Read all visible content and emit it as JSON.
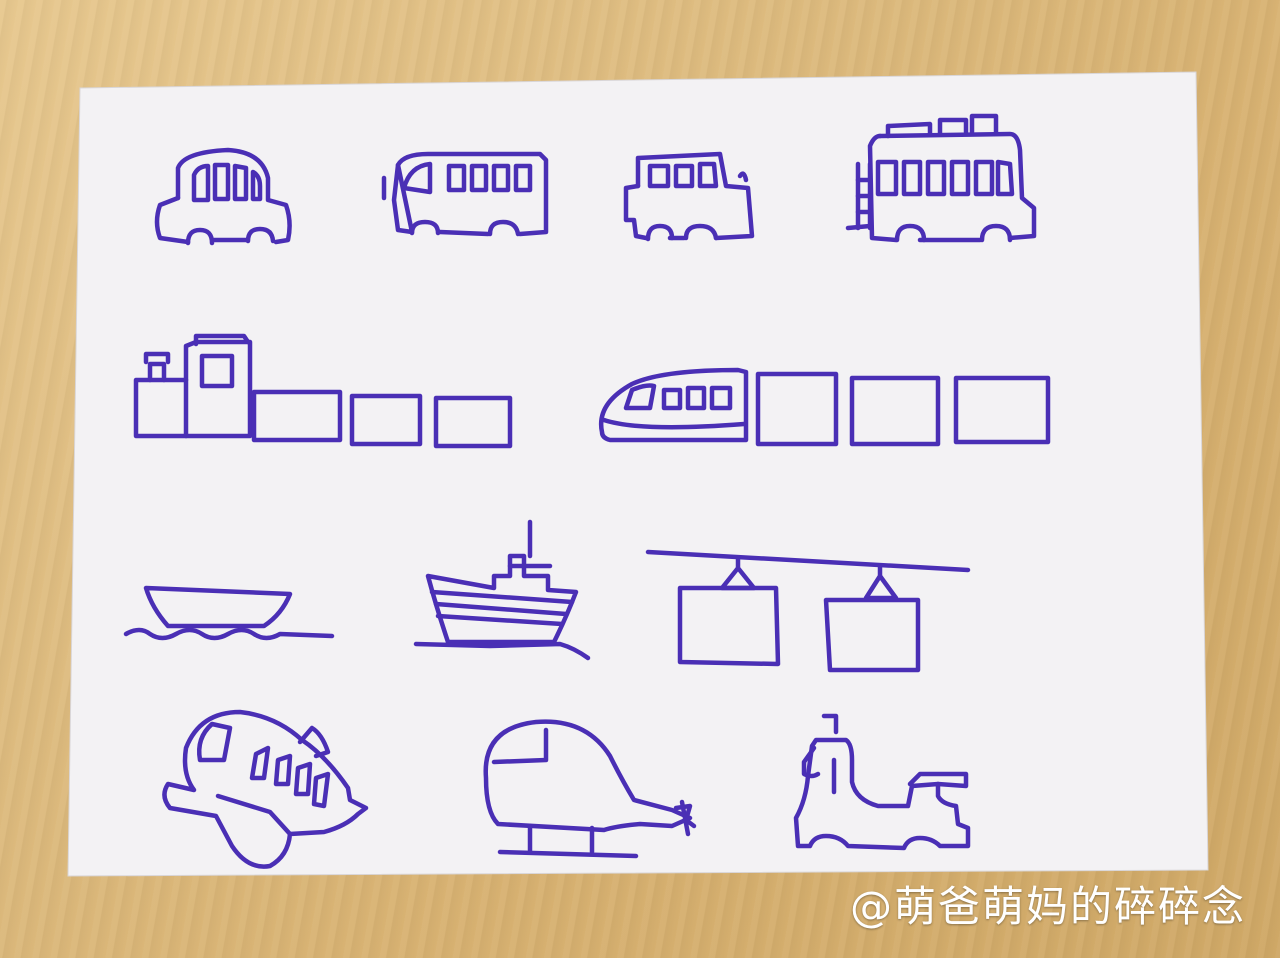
{
  "watermark": {
    "text": "@萌爸萌妈的碎碎念"
  },
  "colors": {
    "ink": "#4a2fb5",
    "paper": "#f2f1f3",
    "table": "#dcb97c"
  },
  "drawings": [
    "car",
    "minibus",
    "van",
    "camper-bus",
    "steam-train",
    "high-speed-train",
    "rowboat",
    "ship",
    "cable-car",
    "airplane",
    "helicopter",
    "scooter"
  ]
}
